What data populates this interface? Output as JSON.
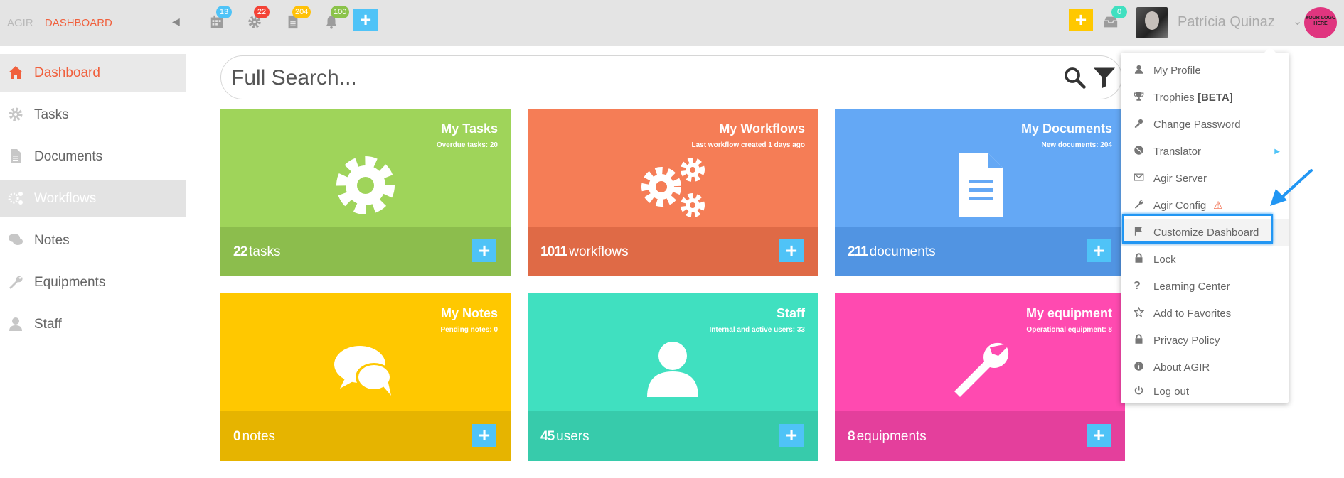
{
  "brand": {
    "name": "AGIR",
    "section": "DASHBOARD"
  },
  "topbar": {
    "badges": [
      {
        "icon": "calendar-icon",
        "count": "13",
        "color": "#4fc3f7"
      },
      {
        "icon": "gear-icon",
        "count": "22",
        "color": "#f44336"
      },
      {
        "icon": "document-icon",
        "count": "204",
        "color": "#ffc107"
      },
      {
        "icon": "bell-icon",
        "count": "100",
        "color": "#8bc34a"
      }
    ],
    "add_label": "+",
    "quick_add_label": "+",
    "inbox_count": "0",
    "user_name": "Patrícia Quinaz",
    "logo_text": "YOUR LOGO HERE"
  },
  "sidebar": {
    "items": [
      {
        "label": "Dashboard",
        "icon": "home-icon"
      },
      {
        "label": "Tasks",
        "icon": "gear-icon"
      },
      {
        "label": "Documents",
        "icon": "document-icon"
      },
      {
        "label": "Workflows",
        "icon": "gears-icon"
      },
      {
        "label": "Notes",
        "icon": "comments-icon"
      },
      {
        "label": "Equipments",
        "icon": "wrench-icon"
      },
      {
        "label": "Staff",
        "icon": "user-icon"
      }
    ]
  },
  "search": {
    "placeholder": "Full Search..."
  },
  "tiles": [
    {
      "title": "My Tasks",
      "subtitle": "Overdue tasks: 20",
      "count": "22",
      "unit": "tasks",
      "color": "#9fd45a",
      "footer_color": "#8cbd4d",
      "icon": "gear-icon"
    },
    {
      "title": "My Workflows",
      "subtitle": "Last workflow created 1 days ago",
      "count": "1011",
      "unit": "workflows",
      "color": "#f57d56",
      "footer_color": "#df6a46",
      "icon": "gears-icon"
    },
    {
      "title": "My Documents",
      "subtitle": "New documents: 204",
      "count": "211",
      "unit": "documents",
      "color": "#64a8f5",
      "footer_color": "#5194e2",
      "icon": "document-icon"
    },
    {
      "title": "My Notes",
      "subtitle": "Pending notes: 0",
      "count": "0",
      "unit": "notes",
      "color": "#ffc800",
      "footer_color": "#e6b400",
      "icon": "comments-icon"
    },
    {
      "title": "Staff",
      "subtitle": "Internal and active users: 33",
      "count": "45",
      "unit": "users",
      "color": "#40e0c0",
      "footer_color": "#37cbab",
      "icon": "user-icon"
    },
    {
      "title": "My equipment",
      "subtitle": "Operational equipment: 8",
      "count": "8",
      "unit": "equipments",
      "color": "#ff4ab0",
      "footer_color": "#e43f9c",
      "icon": "wrench-icon"
    }
  ],
  "menu": {
    "items": [
      {
        "label": "My Profile",
        "icon": "user-icon"
      },
      {
        "label": "Trophies",
        "extra": "[BETA]",
        "icon": "trophy-icon"
      },
      {
        "label": "Change Password",
        "icon": "key-icon"
      },
      {
        "label": "Translator",
        "icon": "globe-icon"
      },
      {
        "label": "Agir Server",
        "icon": "envelope-icon"
      },
      {
        "label": "Agir Config",
        "icon": "wrench-icon"
      },
      {
        "label": "Customize Dashboard",
        "icon": "flag-icon"
      },
      {
        "label": "Lock",
        "icon": "lock-icon"
      },
      {
        "label": "Learning Center",
        "icon": "question-icon"
      },
      {
        "label": "Add to Favorites",
        "icon": "star-icon"
      },
      {
        "label": "Privacy Policy",
        "icon": "lock-icon"
      },
      {
        "label": "About AGIR",
        "icon": "info-icon"
      },
      {
        "label": "Log out",
        "icon": "power-icon"
      }
    ]
  }
}
